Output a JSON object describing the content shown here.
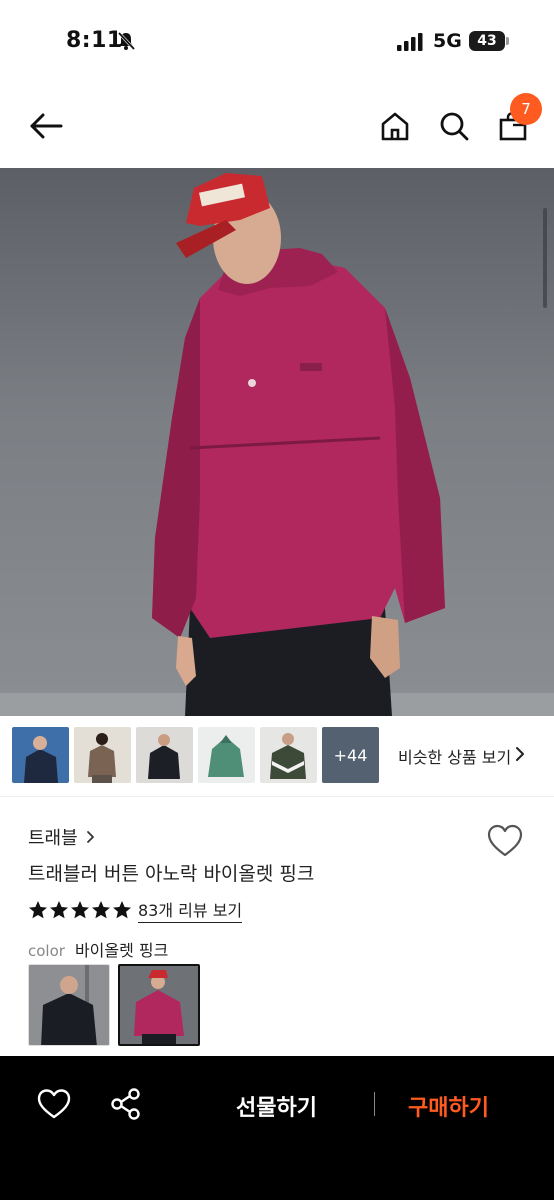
{
  "status_bar": {
    "time": "8:11",
    "network": "5G",
    "battery": "43"
  },
  "header": {
    "cart_count": "7",
    "icons": [
      "back-arrow-icon",
      "home-icon",
      "search-icon",
      "cart-icon"
    ]
  },
  "gallery": {
    "thumbnails": [
      {
        "name": "thumb-navy-jacket",
        "color": "#27334a"
      },
      {
        "name": "thumb-brown-jacket",
        "color": "#7a6352"
      },
      {
        "name": "thumb-black-jacket",
        "color": "#1c1f26"
      },
      {
        "name": "thumb-green-jacket",
        "color": "#4f8f78"
      },
      {
        "name": "thumb-khaki-jacket",
        "color": "#3e4a38"
      }
    ],
    "more_count": "+44",
    "similar_label": "비슷한 상품 보기"
  },
  "product": {
    "brand": "트래블",
    "title": "트래블러 버튼 아노락 바이올렛 핑크",
    "rating": 5,
    "reviews_label": "83개 리뷰 보기",
    "color_label": "color",
    "color_value": "바이올렛 핑크",
    "accent_color": "#ff5a1f",
    "jacket_color": "#b0285e"
  },
  "bottom_bar": {
    "gift_label": "선물하기",
    "buy_label": "구매하기"
  }
}
